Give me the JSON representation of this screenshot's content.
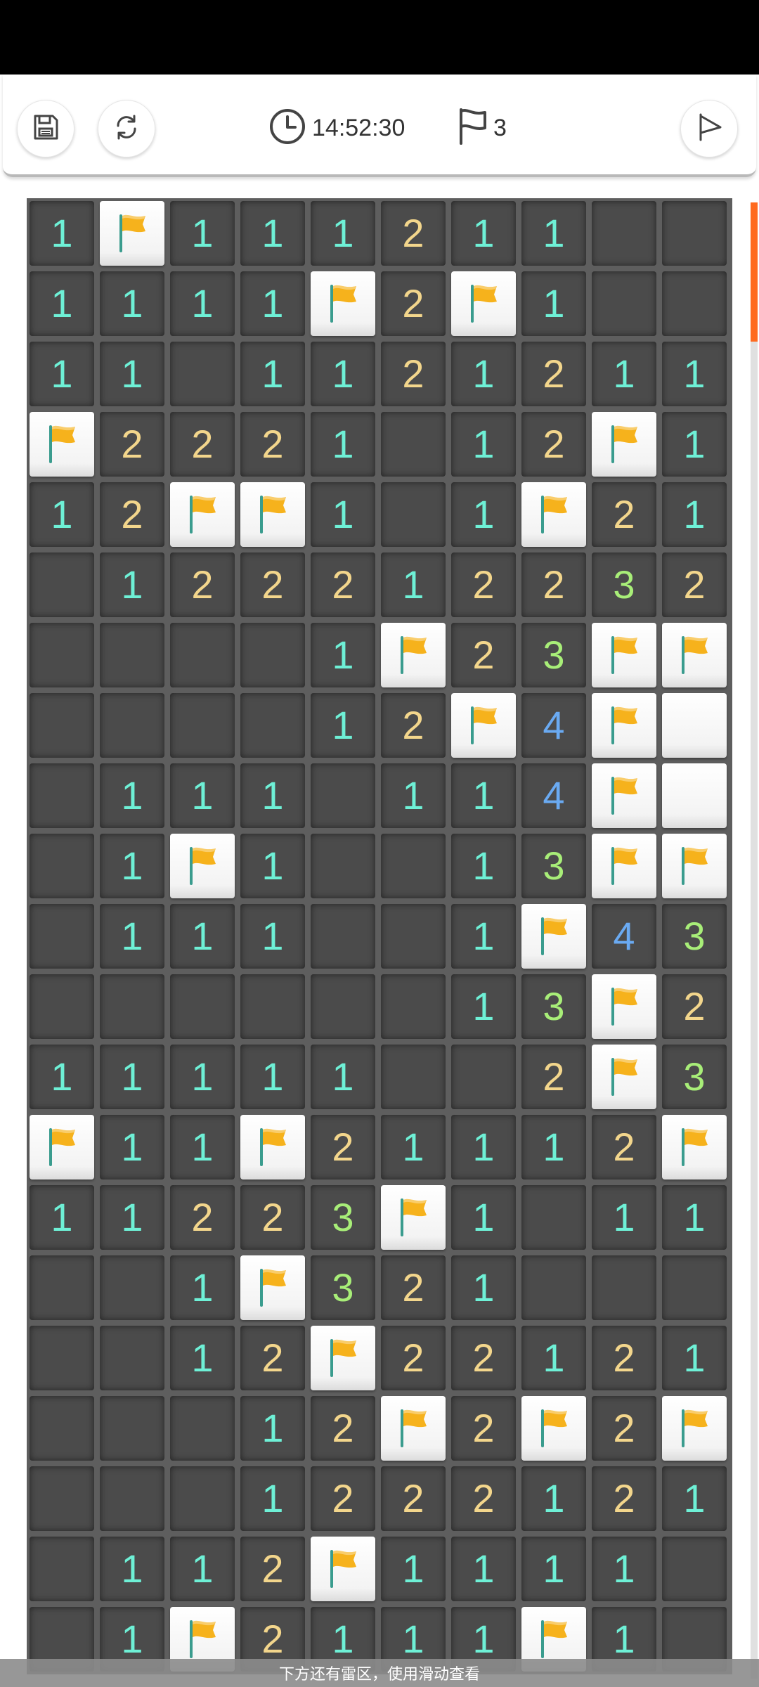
{
  "toolbar": {
    "save_icon": "save-icon",
    "restart_icon": "restart-icon",
    "clock_icon": "clock-icon",
    "timer": "14:52:30",
    "flag_icon": "flag-icon",
    "flag_count": "3",
    "play_icon": "play-icon"
  },
  "board": {
    "rows": [
      [
        "1",
        "F",
        "1",
        "1",
        "1",
        "2",
        "1",
        "1",
        "",
        ""
      ],
      [
        "1",
        "1",
        "1",
        "1",
        "F",
        "2",
        "F",
        "1",
        "",
        ""
      ],
      [
        "1",
        "1",
        "",
        "1",
        "1",
        "2",
        "1",
        "2",
        "1",
        "1"
      ],
      [
        "F",
        "2",
        "2",
        "2",
        "1",
        "",
        "1",
        "2",
        "F",
        "1"
      ],
      [
        "1",
        "2",
        "F",
        "F",
        "1",
        "",
        "1",
        "F",
        "2",
        "1"
      ],
      [
        "",
        "1",
        "2",
        "2",
        "2",
        "1",
        "2",
        "2",
        "3",
        "2"
      ],
      [
        "",
        "",
        "",
        "",
        "1",
        "F",
        "2",
        "3",
        "F",
        "F"
      ],
      [
        "",
        "",
        "",
        "",
        "1",
        "2",
        "F",
        "4",
        "F",
        "C"
      ],
      [
        "",
        "1",
        "1",
        "1",
        "",
        "1",
        "1",
        "4",
        "F",
        "C"
      ],
      [
        "",
        "1",
        "F",
        "1",
        "",
        "",
        "1",
        "3",
        "F",
        "F"
      ],
      [
        "",
        "1",
        "1",
        "1",
        "",
        "",
        "1",
        "F",
        "4",
        "3"
      ],
      [
        "",
        "",
        "",
        "",
        "",
        "",
        "1",
        "3",
        "F",
        "2"
      ],
      [
        "1",
        "1",
        "1",
        "1",
        "1",
        "",
        "",
        "2",
        "F",
        "3"
      ],
      [
        "F",
        "1",
        "1",
        "F",
        "2",
        "1",
        "1",
        "1",
        "2",
        "F"
      ],
      [
        "1",
        "1",
        "2",
        "2",
        "3",
        "F",
        "1",
        "",
        "1",
        "1"
      ],
      [
        "",
        "",
        "1",
        "F",
        "3",
        "2",
        "1",
        "",
        "",
        ""
      ],
      [
        "",
        "",
        "1",
        "2",
        "F",
        "2",
        "2",
        "1",
        "2",
        "1"
      ],
      [
        "",
        "",
        "",
        "1",
        "2",
        "F",
        "2",
        "F",
        "2",
        "F"
      ],
      [
        "",
        "",
        "",
        "1",
        "2",
        "2",
        "2",
        "1",
        "2",
        "1"
      ],
      [
        "",
        "1",
        "1",
        "2",
        "F",
        "1",
        "1",
        "1",
        "1",
        ""
      ],
      [
        "",
        "1",
        "F",
        "2",
        "1",
        "1",
        "1",
        "F",
        "1",
        ""
      ]
    ],
    "colors": {
      "1": "#6ef0d6",
      "2": "#f3d68c",
      "3": "#a8ee78",
      "4": "#6aaaf2",
      "flag": "#f6b21c",
      "scroll_accent": "#ff6a1f"
    }
  },
  "hint_text": "下方还有雷区，使用滑动查看"
}
